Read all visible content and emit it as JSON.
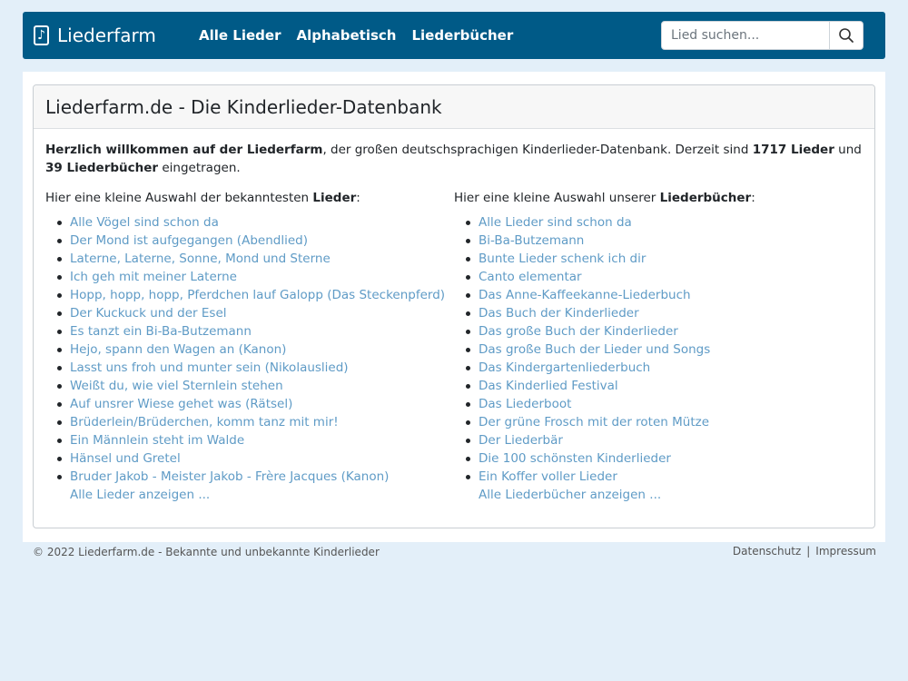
{
  "navbar": {
    "brand": "Liederfarm",
    "brand_icon": "music-note-icon",
    "links": [
      "Alle Lieder",
      "Alphabetisch",
      "Liederbücher"
    ],
    "search_placeholder": "Lied suchen...",
    "search_icon": "search-icon",
    "color": "#005a87"
  },
  "card": {
    "title": "Liederfarm.de - Die Kinderlieder-Datenbank",
    "intro": {
      "welcome_bold": "Herzlich willkommen auf der Liederfarm",
      "text_1": ", der großen deutschsprachigen Kinderlieder-Datenbank. Derzeit sind ",
      "songs_count": "1717 Lieder",
      "text_2": " und ",
      "books_count": "39 Liederbücher",
      "text_3": " eingetragen."
    },
    "songs": {
      "heading_pre": "Hier eine kleine Auswahl der bekanntesten ",
      "heading_bold": "Lieder",
      "heading_post": ":",
      "items": [
        "Alle Vögel sind schon da",
        "Der Mond ist aufgegangen (Abendlied)",
        "Laterne, Laterne, Sonne, Mond und Sterne",
        "Ich geh mit meiner Laterne",
        "Hopp, hopp, hopp, Pferdchen lauf Galopp (Das Steckenpferd)",
        "Der Kuckuck und der Esel",
        "Es tanzt ein Bi-Ba-Butzemann",
        "Hejo, spann den Wagen an (Kanon)",
        "Lasst uns froh und munter sein (Nikolauslied)",
        "Weißt du, wie viel Sternlein stehen",
        "Auf unsrer Wiese gehet was (Rätsel)",
        "Brüderlein/Brüderchen, komm tanz mit mir!",
        "Ein Männlein steht im Walde",
        "Hänsel und Gretel",
        "Bruder Jakob - Meister Jakob - Frère Jacques (Kanon)"
      ],
      "more": "Alle Lieder anzeigen ..."
    },
    "books": {
      "heading_pre": "Hier eine kleine Auswahl unserer ",
      "heading_bold": "Liederbücher",
      "heading_post": ":",
      "items": [
        "Alle Lieder sind schon da",
        "Bi-Ba-Butzemann",
        "Bunte Lieder schenk ich dir",
        "Canto elementar",
        "Das Anne-Kaffeekanne-Liederbuch",
        "Das Buch der Kinderlieder",
        "Das große Buch der Kinderlieder",
        "Das große Buch der Lieder und Songs",
        "Das Kindergartenliederbuch",
        "Das Kinderlied Festival",
        "Das Liederboot",
        "Der grüne Frosch mit der roten Mütze",
        "Der Liederbär",
        "Die 100 schönsten Kinderlieder",
        "Ein Koffer voller Lieder"
      ],
      "more": "Alle Liederbücher anzeigen ..."
    }
  },
  "footer": {
    "copyright": "© 2022 Liederfarm.de - Bekannte und unbekannte Kinderlieder",
    "links": [
      "Datenschutz",
      "Impressum"
    ],
    "separator": "|"
  },
  "colors": {
    "link": "#5f9bc6",
    "background": "#e3eff9"
  }
}
